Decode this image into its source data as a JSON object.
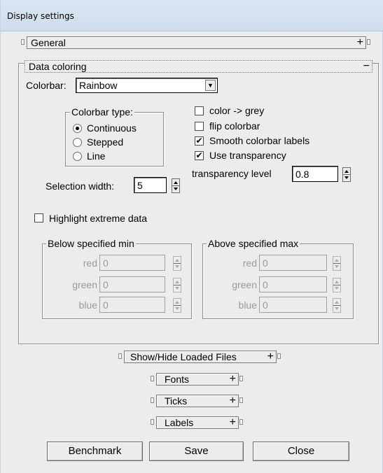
{
  "window": {
    "title": "Display settings"
  },
  "sections": {
    "general": {
      "label": "General",
      "toggle": "+"
    },
    "data_coloring": {
      "label": "Data coloring",
      "toggle": "−"
    },
    "show_hide": {
      "label": "Show/Hide Loaded Files",
      "toggle": "+"
    },
    "fonts": {
      "label": "Fonts",
      "toggle": "+"
    },
    "ticks": {
      "label": "Ticks",
      "toggle": "+"
    },
    "labels": {
      "label": "Labels",
      "toggle": "+"
    }
  },
  "colorbar": {
    "label": "Colorbar:",
    "selected": "Rainbow",
    "arrow": "▼",
    "type_group": {
      "title": "Colorbar type:",
      "options": [
        {
          "label": "Continuous",
          "selected": true
        },
        {
          "label": "Stepped",
          "selected": false
        },
        {
          "label": "Line",
          "selected": false
        }
      ]
    }
  },
  "options": [
    {
      "label": "color -> grey",
      "checked": false,
      "mark": ""
    },
    {
      "label": "flip colorbar",
      "checked": false,
      "mark": ""
    },
    {
      "label": "Smooth colorbar labels",
      "checked": true,
      "mark": "✔"
    },
    {
      "label": "Use transparency",
      "checked": true,
      "mark": "✔"
    }
  ],
  "transparency": {
    "label": "transparency level",
    "value": "0.8"
  },
  "selection_width": {
    "label": "Selection width:",
    "value": "5"
  },
  "highlight": {
    "label": "Highlight extreme data",
    "checked": false
  },
  "below_min": {
    "title": "Below specified min",
    "fields": [
      {
        "label": "red",
        "value": "0"
      },
      {
        "label": "green",
        "value": "0"
      },
      {
        "label": "blue",
        "value": "0"
      }
    ]
  },
  "above_max": {
    "title": "Above specified max",
    "fields": [
      {
        "label": "red",
        "value": "0"
      },
      {
        "label": "green",
        "value": "0"
      },
      {
        "label": "blue",
        "value": "0"
      }
    ]
  },
  "buttons": {
    "benchmark": "Benchmark",
    "save": "Save",
    "close": "Close"
  }
}
